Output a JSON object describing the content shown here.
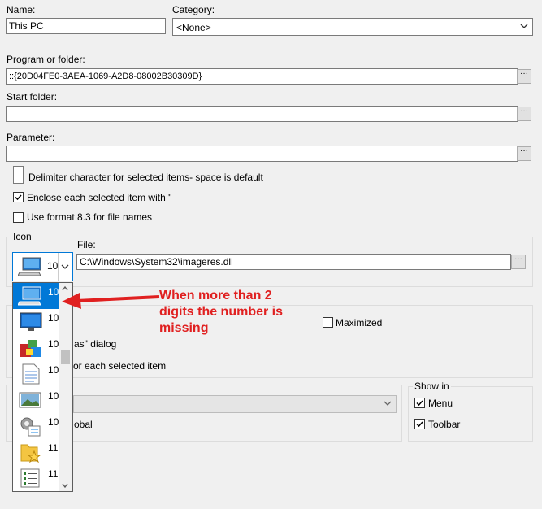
{
  "name": {
    "label": "Name:",
    "value": "This PC"
  },
  "category": {
    "label": "Category:",
    "value": "<None>"
  },
  "program": {
    "label": "Program or folder:",
    "value": "::{20D04FE0-3AEA-1069-A2D8-08002B30309D}"
  },
  "start_folder": {
    "label": "Start folder:",
    "value": ""
  },
  "parameter": {
    "label": "Parameter:",
    "value": ""
  },
  "options": {
    "delimiter": "Delimiter character for selected items- space is default",
    "enclose": "Enclose each selected item with \"",
    "format83": "Use format 8.3 for file names",
    "enclose_checked": true,
    "format83_checked": false
  },
  "icon": {
    "group_label": "Icon",
    "file_label": "File:",
    "file_value": "C:\\Windows\\System32\\imageres.dll",
    "selected_num": "10"
  },
  "dropdown_items": [
    {
      "num": "10",
      "icon": "computer-icon",
      "selected": true
    },
    {
      "num": "10",
      "icon": "monitor-icon",
      "selected": false
    },
    {
      "num": "10",
      "icon": "installer-icon",
      "selected": false
    },
    {
      "num": "10",
      "icon": "document-icon",
      "selected": false
    },
    {
      "num": "10",
      "icon": "picture-icon",
      "selected": false
    },
    {
      "num": "10",
      "icon": "settings-icon",
      "selected": false
    },
    {
      "num": "11",
      "icon": "folder-star-icon",
      "selected": false
    },
    {
      "num": "11",
      "icon": "list-icon",
      "selected": false
    }
  ],
  "hidden_fragments": {
    "maximized": "Maximized",
    "maximized_checked": false,
    "as_dialog": "as\" dialog",
    "each_item": "or each selected item",
    "global": "obal"
  },
  "show_in": {
    "label": "Show in",
    "menu": "Menu",
    "toolbar": "Toolbar",
    "menu_checked": true,
    "toolbar_checked": true
  },
  "annotation": {
    "text": "When more than 2 digits the number is missing",
    "color": "#e02020"
  }
}
